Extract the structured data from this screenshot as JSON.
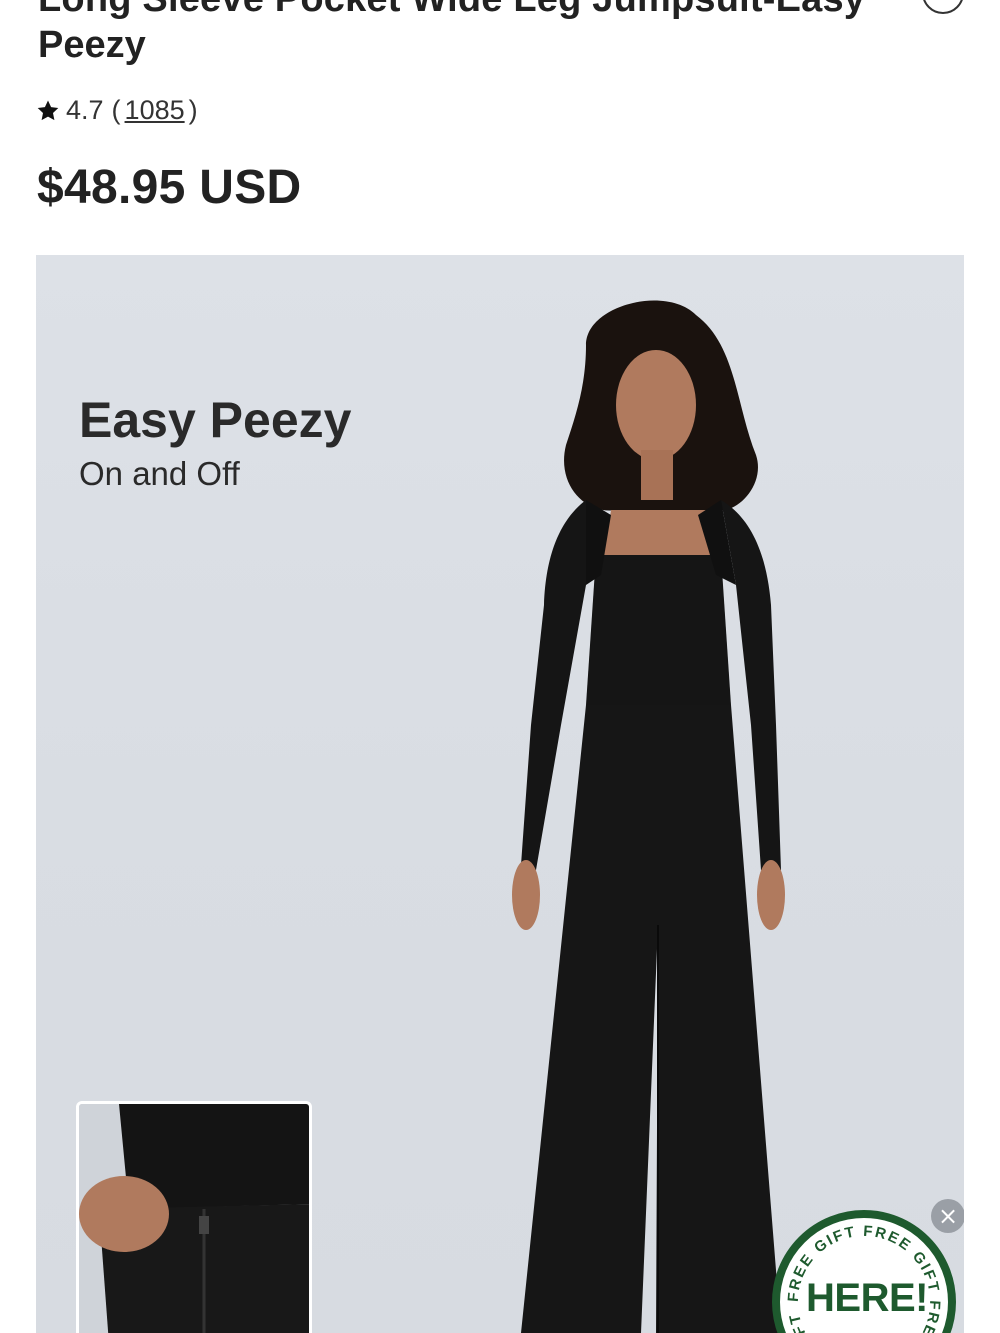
{
  "product": {
    "title_line1": "Long Sleeve Pocket Wide Leg Jumpsuit-Easy",
    "title_line2": "Peezy",
    "rating": "4.7",
    "review_open": "(",
    "review_count": "1085",
    "review_close": ")",
    "price": "$48.95 USD"
  },
  "image": {
    "promo_title": "Easy Peezy",
    "promo_subtitle": "On and Off"
  },
  "gift_badge": {
    "ring_text": "FREE GIFT FREE GIFT FREE GIFT FREE GIFT",
    "center_text": "HERE!",
    "close_icon": "×"
  },
  "icons": {
    "rating": "star-icon",
    "favorite": "heart-icon",
    "close": "close-icon"
  },
  "colors": {
    "background": "#ffffff",
    "image_bg": "#dde1e7",
    "garment": "#151515",
    "gift_green": "#1e5a2e"
  }
}
